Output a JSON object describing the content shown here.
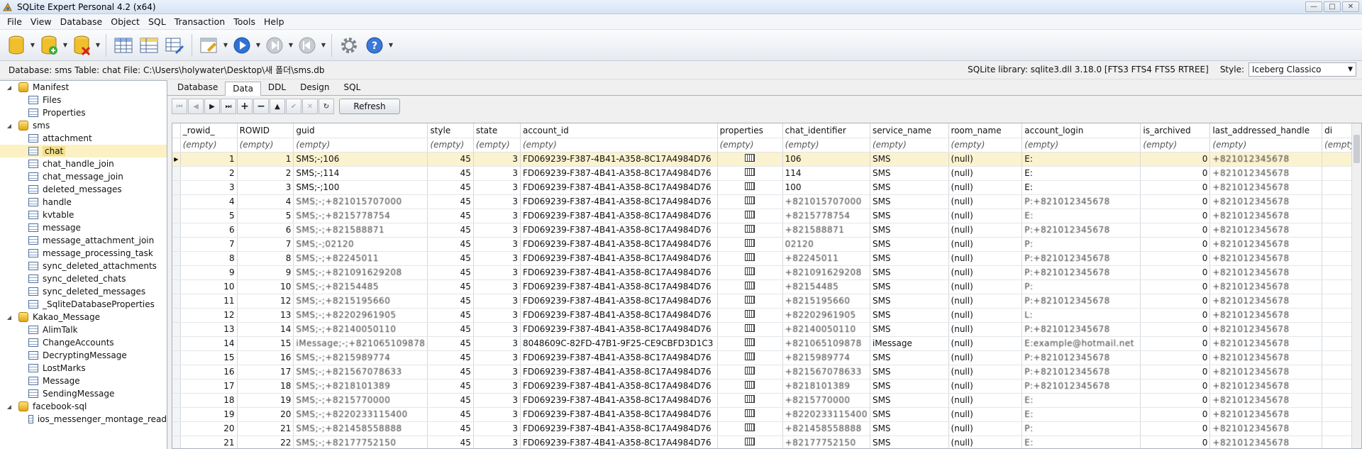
{
  "window": {
    "title": "SQLite Expert Personal 4.2 (x64)"
  },
  "menu": [
    "File",
    "View",
    "Database",
    "Object",
    "SQL",
    "Transaction",
    "Tools",
    "Help"
  ],
  "infobar": {
    "left": "Database: sms  Table: chat  File: C:\\Users\\holywater\\Desktop\\새 폴더\\sms.db",
    "library": "SQLite library: sqlite3.dll 3.18.0 [FTS3 FTS4 FTS5 RTREE]",
    "style_label": "Style:",
    "style_value": "Iceberg Classico"
  },
  "tree": [
    {
      "label": "Manifest",
      "level": 0,
      "type": "db"
    },
    {
      "label": "Files",
      "level": 1,
      "type": "table"
    },
    {
      "label": "Properties",
      "level": 1,
      "type": "table"
    },
    {
      "label": "sms",
      "level": 0,
      "type": "db"
    },
    {
      "label": "attachment",
      "level": 1,
      "type": "table"
    },
    {
      "label": "chat",
      "level": 1,
      "type": "table",
      "selected": true
    },
    {
      "label": "chat_handle_join",
      "level": 1,
      "type": "table"
    },
    {
      "label": "chat_message_join",
      "level": 1,
      "type": "table"
    },
    {
      "label": "deleted_messages",
      "level": 1,
      "type": "table"
    },
    {
      "label": "handle",
      "level": 1,
      "type": "table"
    },
    {
      "label": "kvtable",
      "level": 1,
      "type": "table"
    },
    {
      "label": "message",
      "level": 1,
      "type": "table"
    },
    {
      "label": "message_attachment_join",
      "level": 1,
      "type": "table"
    },
    {
      "label": "message_processing_task",
      "level": 1,
      "type": "table"
    },
    {
      "label": "sync_deleted_attachments",
      "level": 1,
      "type": "table"
    },
    {
      "label": "sync_deleted_chats",
      "level": 1,
      "type": "table"
    },
    {
      "label": "sync_deleted_messages",
      "level": 1,
      "type": "table"
    },
    {
      "label": "_SqliteDatabaseProperties",
      "level": 1,
      "type": "table"
    },
    {
      "label": "Kakao_Message",
      "level": 0,
      "type": "db"
    },
    {
      "label": "AlimTalk",
      "level": 1,
      "type": "table"
    },
    {
      "label": "ChangeAccounts",
      "level": 1,
      "type": "table"
    },
    {
      "label": "DecryptingMessage",
      "level": 1,
      "type": "table"
    },
    {
      "label": "LostMarks",
      "level": 1,
      "type": "table"
    },
    {
      "label": "Message",
      "level": 1,
      "type": "table"
    },
    {
      "label": "SendingMessage",
      "level": 1,
      "type": "table"
    },
    {
      "label": "facebook-sql",
      "level": 0,
      "type": "db"
    },
    {
      "label": "ios_messenger_montage_read",
      "level": 1,
      "type": "table"
    }
  ],
  "tabs": [
    "Database",
    "Data",
    "DDL",
    "Design",
    "SQL"
  ],
  "active_tab": "Data",
  "refresh_label": "Refresh",
  "grid": {
    "columns": [
      "_rowid_",
      "ROWID",
      "guid",
      "style",
      "state",
      "account_id",
      "properties",
      "chat_identifier",
      "service_name",
      "room_name",
      "account_login",
      "is_archived",
      "last_addressed_handle",
      "di"
    ],
    "filter_placeholder": "(empty)",
    "rows": [
      [
        "1",
        "1",
        "SMS;-;106",
        "45",
        "3",
        "FD069239-F387-4B41-A358-8C17A4984D76",
        "",
        "106",
        "SMS",
        "(null)",
        "E:",
        "0",
        "+821012345678"
      ],
      [
        "2",
        "2",
        "SMS;-;114",
        "45",
        "3",
        "FD069239-F387-4B41-A358-8C17A4984D76",
        "",
        "114",
        "SMS",
        "(null)",
        "E:",
        "0",
        "+821012345678"
      ],
      [
        "3",
        "3",
        "SMS;-;100",
        "45",
        "3",
        "FD069239-F387-4B41-A358-8C17A4984D76",
        "",
        "100",
        "SMS",
        "(null)",
        "E:",
        "0",
        "+821012345678"
      ],
      [
        "4",
        "4",
        "SMS;-;+821015707000",
        "45",
        "3",
        "FD069239-F387-4B41-A358-8C17A4984D76",
        "",
        "+821015707000",
        "SMS",
        "(null)",
        "P:+821012345678",
        "0",
        "+821012345678"
      ],
      [
        "5",
        "5",
        "SMS;-;+8215778754",
        "45",
        "3",
        "FD069239-F387-4B41-A358-8C17A4984D76",
        "",
        "+8215778754",
        "SMS",
        "(null)",
        "E:",
        "0",
        "+821012345678"
      ],
      [
        "6",
        "6",
        "SMS;-;+821588871",
        "45",
        "3",
        "FD069239-F387-4B41-A358-8C17A4984D76",
        "",
        "+821588871",
        "SMS",
        "(null)",
        "P:+821012345678",
        "0",
        "+821012345678"
      ],
      [
        "7",
        "7",
        "SMS;-;02120",
        "45",
        "3",
        "FD069239-F387-4B41-A358-8C17A4984D76",
        "",
        "02120",
        "SMS",
        "(null)",
        "P:",
        "0",
        "+821012345678"
      ],
      [
        "8",
        "8",
        "SMS;-;+82245011",
        "45",
        "3",
        "FD069239-F387-4B41-A358-8C17A4984D76",
        "",
        "+82245011",
        "SMS",
        "(null)",
        "P:+821012345678",
        "0",
        "+821012345678"
      ],
      [
        "9",
        "9",
        "SMS;-;+821091629208",
        "45",
        "3",
        "FD069239-F387-4B41-A358-8C17A4984D76",
        "",
        "+821091629208",
        "SMS",
        "(null)",
        "P:+821012345678",
        "0",
        "+821012345678"
      ],
      [
        "10",
        "10",
        "SMS;-;+82154485",
        "45",
        "3",
        "FD069239-F387-4B41-A358-8C17A4984D76",
        "",
        "+82154485",
        "SMS",
        "(null)",
        "P:",
        "0",
        "+821012345678"
      ],
      [
        "11",
        "12",
        "SMS;-;+8215195660",
        "45",
        "3",
        "FD069239-F387-4B41-A358-8C17A4984D76",
        "",
        "+8215195660",
        "SMS",
        "(null)",
        "P:+821012345678",
        "0",
        "+821012345678"
      ],
      [
        "12",
        "13",
        "SMS;-;+82202961905",
        "45",
        "3",
        "FD069239-F387-4B41-A358-8C17A4984D76",
        "",
        "+82202961905",
        "SMS",
        "(null)",
        "L:",
        "0",
        "+821012345678"
      ],
      [
        "13",
        "14",
        "SMS;-;+82140050110",
        "45",
        "3",
        "FD069239-F387-4B41-A358-8C17A4984D76",
        "",
        "+82140050110",
        "SMS",
        "(null)",
        "P:+821012345678",
        "0",
        "+821012345678"
      ],
      [
        "14",
        "15",
        "iMessage;-;+821065109878",
        "45",
        "3",
        "8048609C-82FD-47B1-9F25-CE9CBFD3D1C3",
        "",
        "+821065109878",
        "iMessage",
        "(null)",
        "E:example@hotmail.net",
        "0",
        "+821012345678"
      ],
      [
        "15",
        "16",
        "SMS;-;+8215989774",
        "45",
        "3",
        "FD069239-F387-4B41-A358-8C17A4984D76",
        "",
        "+8215989774",
        "SMS",
        "(null)",
        "P:+821012345678",
        "0",
        "+821012345678"
      ],
      [
        "16",
        "17",
        "SMS;-;+821567078633",
        "45",
        "3",
        "FD069239-F387-4B41-A358-8C17A4984D76",
        "",
        "+821567078633",
        "SMS",
        "(null)",
        "P:+821012345678",
        "0",
        "+821012345678"
      ],
      [
        "17",
        "18",
        "SMS;-;+8218101389",
        "45",
        "3",
        "FD069239-F387-4B41-A358-8C17A4984D76",
        "",
        "+8218101389",
        "SMS",
        "(null)",
        "P:+821012345678",
        "0",
        "+821012345678"
      ],
      [
        "18",
        "19",
        "SMS;-;+8215770000",
        "45",
        "3",
        "FD069239-F387-4B41-A358-8C17A4984D76",
        "",
        "+8215770000",
        "SMS",
        "(null)",
        "E:",
        "0",
        "+821012345678"
      ],
      [
        "19",
        "20",
        "SMS;-;+8220233115400",
        "45",
        "3",
        "FD069239-F387-4B41-A358-8C17A4984D76",
        "",
        "+8220233115400",
        "SMS",
        "(null)",
        "E:",
        "0",
        "+821012345678"
      ],
      [
        "20",
        "21",
        "SMS;-;+821458558888",
        "45",
        "3",
        "FD069239-F387-4B41-A358-8C17A4984D76",
        "",
        "+821458558888",
        "SMS",
        "(null)",
        "P:",
        "0",
        "+821012345678"
      ],
      [
        "21",
        "22",
        "SMS;-;+82177752150",
        "45",
        "3",
        "FD069239-F387-4B41-A358-8C17A4984D76",
        "",
        "+82177752150",
        "SMS",
        "(null)",
        "E:",
        "0",
        "+821012345678"
      ]
    ]
  }
}
